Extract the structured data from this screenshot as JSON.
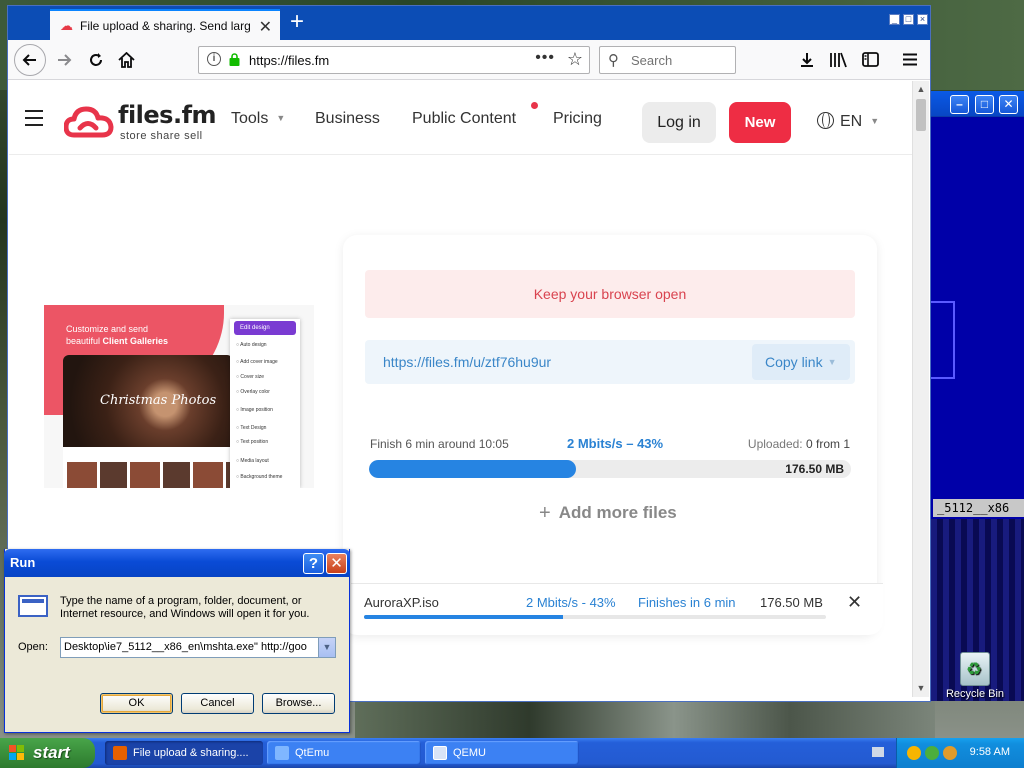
{
  "browser": {
    "tab_title": "File upload & sharing. Send large p",
    "url": "https://files.fm",
    "search_placeholder": "Search"
  },
  "site": {
    "logo_name": "files.fm",
    "logo_tagline": "store share sell",
    "nav": {
      "tools": "Tools",
      "business": "Business",
      "public_content": "Public Content",
      "pricing": "Pricing"
    },
    "login_label": "Log in",
    "new_label": "New",
    "language": "EN"
  },
  "ad": {
    "headline_line1": "Customize and send",
    "headline_line2_pre": "beautiful ",
    "headline_line2_bold": "Client Galleries",
    "photo_title": "Christmas Photos",
    "panel_button": "Edit design",
    "panel_items": [
      "Auto design",
      "Add cover image",
      "Cover size",
      "Overlay color",
      "Image position",
      "Text Design",
      "Text position",
      "Media layout",
      "Background theme"
    ]
  },
  "upload": {
    "keep_open": "Keep your browser open",
    "share_url": "https://files.fm/u/ztf76hu9ur",
    "copy_link": "Copy link",
    "finish_text": "Finish 6 min around 10:05",
    "speed_text": "2 Mbits/s – 43%",
    "uploaded_label": "Uploaded:",
    "uploaded_value": "0 from 1",
    "progress_percent": 43,
    "total_size": "176.50 MB",
    "add_more": "Add more files"
  },
  "file_row": {
    "name": "AuroraXP.iso",
    "speed": "2 Mbits/s - 43%",
    "finishes": "Finishes in 6 min",
    "size": "176.50 MB",
    "progress_percent": 43
  },
  "run_dialog": {
    "title": "Run",
    "message": "Type the name of a program, folder, document, or Internet resource, and Windows will open it for you.",
    "open_label": "Open:",
    "open_value": "Desktop\\ie7_5112__x86_en\\mshta.exe\" http://goo",
    "ok": "OK",
    "cancel": "Cancel",
    "browse": "Browse..."
  },
  "qemu_window": {
    "label": "_5112__x86"
  },
  "desktop": {
    "recycle_bin": "Recycle Bin"
  },
  "taskbar": {
    "start": "start",
    "tasks": [
      "File upload & sharing....",
      "QtEmu",
      "QEMU"
    ],
    "clock": "9:58 AM"
  },
  "colors": {
    "brand_red": "#ee2d44",
    "link_blue": "#2a82d3",
    "progress_blue": "#2684e2",
    "xp_blue": "#0a4bd6"
  },
  "icons": [
    "back-icon",
    "forward-icon",
    "reload-icon",
    "home-icon",
    "info-icon",
    "lock-icon",
    "page-actions-icon",
    "bookmark-star-icon",
    "download-icon",
    "library-icon",
    "sidebar-icon",
    "menu-icon",
    "globe-icon",
    "plus-icon",
    "close-icon",
    "windows-flag-icon"
  ]
}
